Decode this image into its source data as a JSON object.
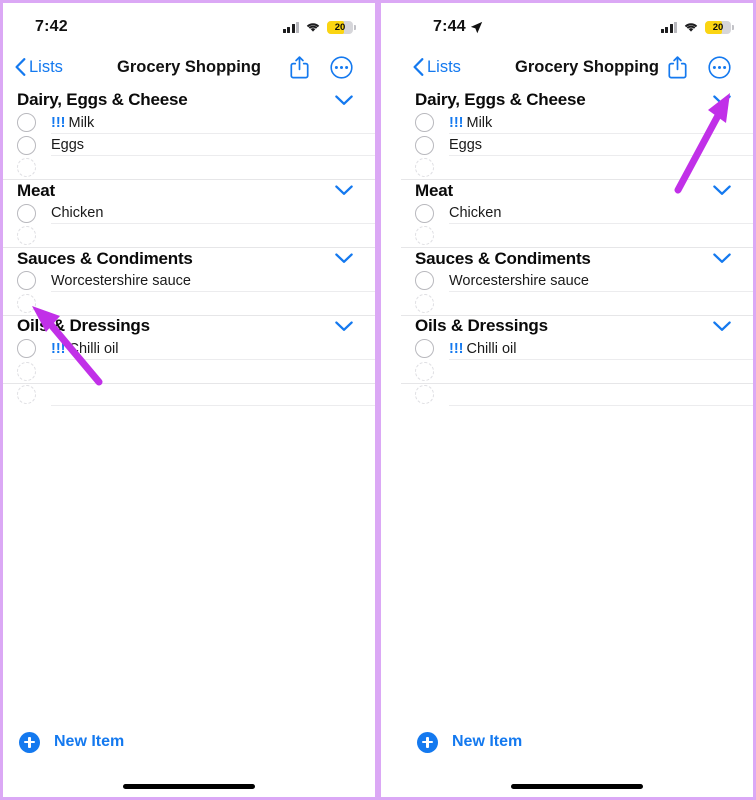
{
  "panels": [
    {
      "id": "left",
      "status": {
        "time": "7:42",
        "location_arrow": false,
        "battery_level": "20",
        "battery_color": "#fbd512",
        "signal_icon": "cellular-bars-icon",
        "wifi_icon": "wifi-icon"
      },
      "nav": {
        "back_label": "Lists",
        "title": "Grocery Shopping",
        "share_icon": "share-icon",
        "more_icon": "more-ellipsis-icon"
      },
      "footer": {
        "new_item_label": "New Item"
      },
      "annotation": {
        "target": "checkbox for Chicken",
        "color": "#c130e8"
      }
    },
    {
      "id": "right",
      "status": {
        "time": "7:44",
        "location_arrow": true,
        "battery_level": "20",
        "battery_color": "#fbd512",
        "signal_icon": "cellular-bars-icon",
        "wifi_icon": "wifi-icon"
      },
      "nav": {
        "back_label": "Lists",
        "title": "Grocery Shopping",
        "share_icon": "share-icon",
        "more_icon": "more-ellipsis-icon"
      },
      "footer": {
        "new_item_label": "New Item"
      },
      "annotation": {
        "target": "more-ellipsis-button",
        "color": "#c130e8"
      }
    }
  ],
  "sections": [
    {
      "title": "Dairy, Eggs & Cheese",
      "chevron": "chevron-down-icon",
      "items": [
        {
          "priority": "!!!",
          "text": "Milk",
          "empty": false
        },
        {
          "priority": "",
          "text": "Eggs",
          "empty": false
        },
        {
          "priority": "",
          "text": "",
          "empty": true
        }
      ]
    },
    {
      "title": "Meat",
      "chevron": "chevron-down-icon",
      "items": [
        {
          "priority": "",
          "text": "Chicken",
          "empty": false
        },
        {
          "priority": "",
          "text": "",
          "empty": true
        }
      ]
    },
    {
      "title": "Sauces & Condiments",
      "chevron": "chevron-down-icon",
      "items": [
        {
          "priority": "",
          "text": "Worcestershire sauce",
          "empty": false
        },
        {
          "priority": "",
          "text": "",
          "empty": true
        }
      ]
    },
    {
      "title": "Oils & Dressings",
      "chevron": "chevron-down-icon",
      "items": [
        {
          "priority": "!!!",
          "text": "Chilli oil",
          "empty": false
        },
        {
          "priority": "",
          "text": "",
          "empty": true
        }
      ]
    },
    {
      "title": "",
      "chevron": "",
      "items": [
        {
          "priority": "",
          "text": "",
          "empty": true
        }
      ]
    }
  ],
  "colors": {
    "accent_blue": "#1479ef",
    "arrow_purple": "#c130e8",
    "panel_border": "#dba8f5",
    "battery_yellow": "#fbd512",
    "text_primary": "#111111",
    "hairline": "#ececee"
  }
}
